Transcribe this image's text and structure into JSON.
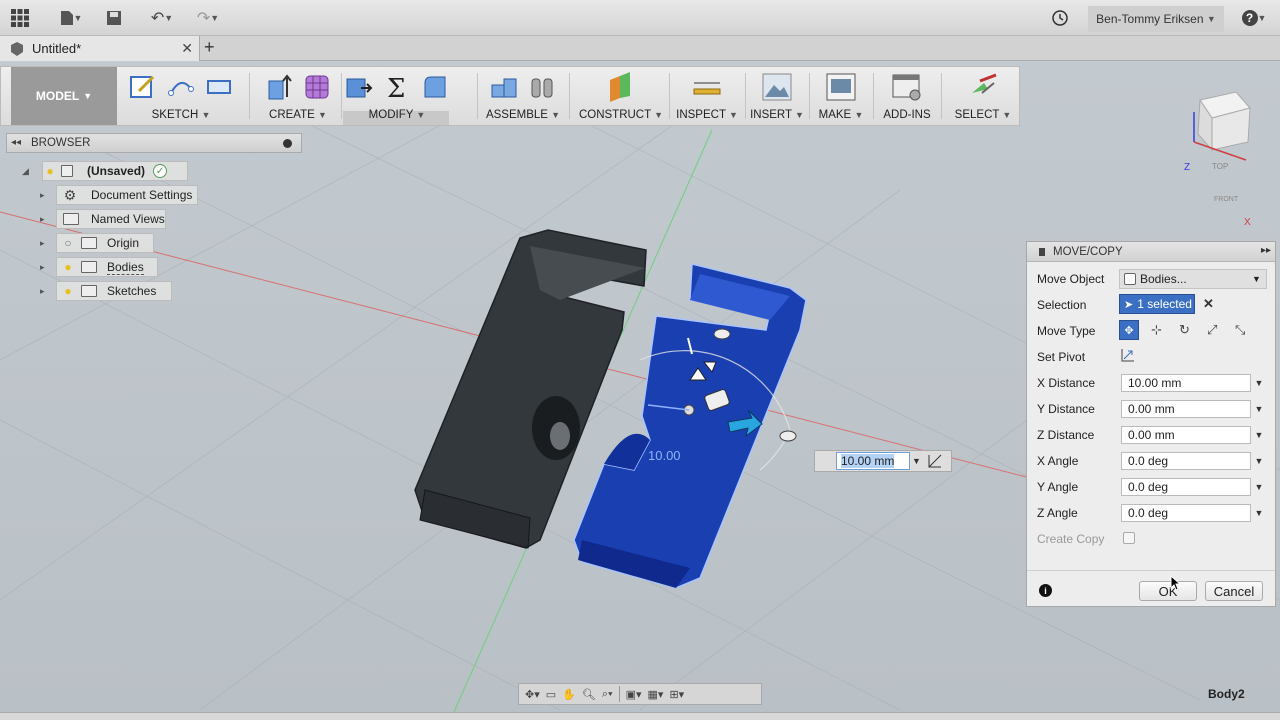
{
  "topbar": {
    "user": "Ben-Tommy Eriksen",
    "help": "?"
  },
  "tab": {
    "title": "Untitled*",
    "close": "✕",
    "new": "+"
  },
  "toolbar": {
    "workspace": "MODEL",
    "groups": {
      "sketch": "SKETCH",
      "create": "CREATE",
      "modify": "MODIFY",
      "assemble": "ASSEMBLE",
      "construct": "CONSTRUCT",
      "inspect": "INSPECT",
      "insert": "INSERT",
      "make": "MAKE",
      "addins": "ADD-INS",
      "select": "SELECT"
    }
  },
  "browser": {
    "title": "BROWSER",
    "root": "(Unsaved)",
    "items": [
      "Document Settings",
      "Named Views",
      "Origin",
      "Bodies",
      "Sketches"
    ]
  },
  "viewcube": {
    "top": "TOP",
    "front": "FRONT",
    "z": "Z",
    "x": "X"
  },
  "manipulator": {
    "distance_label": "10.00",
    "value_input": "10.00 mm"
  },
  "dialog": {
    "title": "MOVE/COPY",
    "move_object_label": "Move Object",
    "move_object_value": "Bodies...",
    "selection_label": "Selection",
    "selection_value": "1 selected",
    "move_type_label": "Move Type",
    "set_pivot_label": "Set Pivot",
    "fields": [
      {
        "label": "X Distance",
        "value": "10.00 mm"
      },
      {
        "label": "Y Distance",
        "value": "0.00 mm"
      },
      {
        "label": "Z Distance",
        "value": "0.00 mm"
      },
      {
        "label": "X Angle",
        "value": "0.0 deg"
      },
      {
        "label": "Y Angle",
        "value": "0.0 deg"
      },
      {
        "label": "Z Angle",
        "value": "0.0 deg"
      }
    ],
    "create_copy_label": "Create Copy",
    "ok": "OK",
    "cancel": "Cancel"
  },
  "status": {
    "selected_body": "Body2"
  },
  "colors": {
    "accent": "#3a6fc4",
    "body_blue": "#1a3fb0",
    "body_dark": "#3a3f44"
  }
}
